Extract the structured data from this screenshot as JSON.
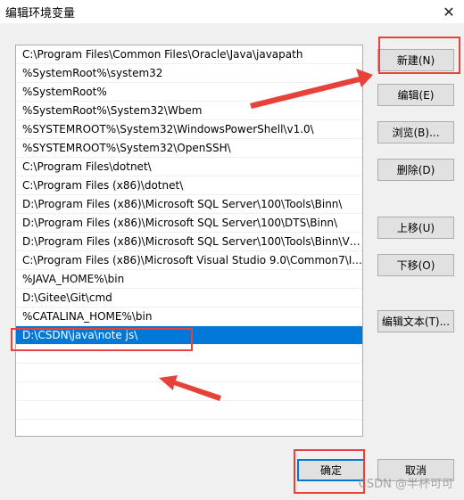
{
  "window": {
    "title": "编辑环境变量",
    "close_icon": "✕"
  },
  "list": {
    "items": [
      "C:\\Program Files\\Common Files\\Oracle\\Java\\javapath",
      "%SystemRoot%\\system32",
      "%SystemRoot%",
      "%SystemRoot%\\System32\\Wbem",
      "%SYSTEMROOT%\\System32\\WindowsPowerShell\\v1.0\\",
      "%SYSTEMROOT%\\System32\\OpenSSH\\",
      "C:\\Program Files\\dotnet\\",
      "C:\\Program Files (x86)\\dotnet\\",
      "D:\\Program Files (x86)\\Microsoft SQL Server\\100\\Tools\\Binn\\",
      "D:\\Program Files (x86)\\Microsoft SQL Server\\100\\DTS\\Binn\\",
      "D:\\Program Files (x86)\\Microsoft SQL Server\\100\\Tools\\Binn\\VS...",
      "C:\\Program Files (x86)\\Microsoft Visual Studio 9.0\\Common7\\I...",
      "%JAVA_HOME%\\bin",
      "D:\\Gitee\\Git\\cmd",
      "%CATALINA_HOME%\\bin",
      "D:\\CSDN\\java\\note js\\"
    ],
    "selected_index": 15
  },
  "buttons": {
    "new": "新建(N)",
    "edit": "编辑(E)",
    "browse": "浏览(B)...",
    "delete": "删除(D)",
    "move_up": "上移(U)",
    "move_down": "下移(O)",
    "edit_text": "编辑文本(T)...",
    "ok": "确定",
    "cancel": "取消"
  },
  "watermark": "CSDN @半杯可可",
  "colors": {
    "selection": "#0078d7",
    "annotation": "#e8413a"
  }
}
